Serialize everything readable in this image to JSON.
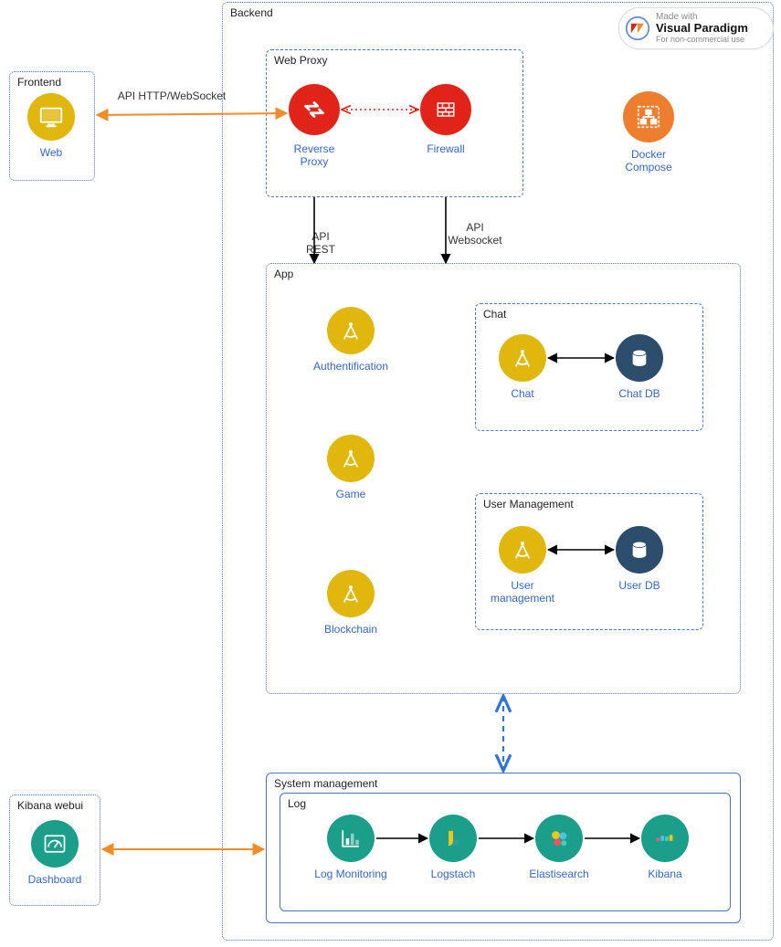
{
  "watermark": {
    "line1": "Made with",
    "line2": "Visual Paradigm",
    "line3": "For non-commercial use"
  },
  "containers": {
    "frontend": "Frontend",
    "backend": "Backend",
    "webproxy": "Web Proxy",
    "app": "App",
    "chat": "Chat",
    "usermgmt": "User Management",
    "sysmgmt": "System management",
    "log": "Log",
    "kibana_webui": "Kibana webui"
  },
  "nodes": {
    "web": "Web",
    "reverse_proxy": "Reverse Proxy",
    "firewall": "Firewall",
    "docker_compose": "Docker Compose",
    "auth": "Authentification",
    "game": "Game",
    "blockchain": "Blockchain",
    "chat_svc": "Chat",
    "chat_db": "Chat DB",
    "user_svc": "User management",
    "user_db": "User DB",
    "log_monitoring": "Log Monitoring",
    "logstash": "Logstach",
    "elasticsearch": "Elastisearch",
    "kibana": "Kibana",
    "dashboard": "Dashboard"
  },
  "edges": {
    "api_http_ws": "API HTTP/WebSocket",
    "api_rest": "API REST",
    "api_ws": "API Websocket"
  },
  "colors": {
    "gold": "#e1b70e",
    "red": "#e2231a",
    "orange": "#ef7d2e",
    "navy": "#2c4e6c",
    "teal": "#1b9e8a",
    "link_blue": "#3366cc",
    "arrow_orange": "#f28c28",
    "arrow_black": "#000000",
    "arrow_blue": "#2f75d6",
    "arrow_red": "#e2231a"
  }
}
